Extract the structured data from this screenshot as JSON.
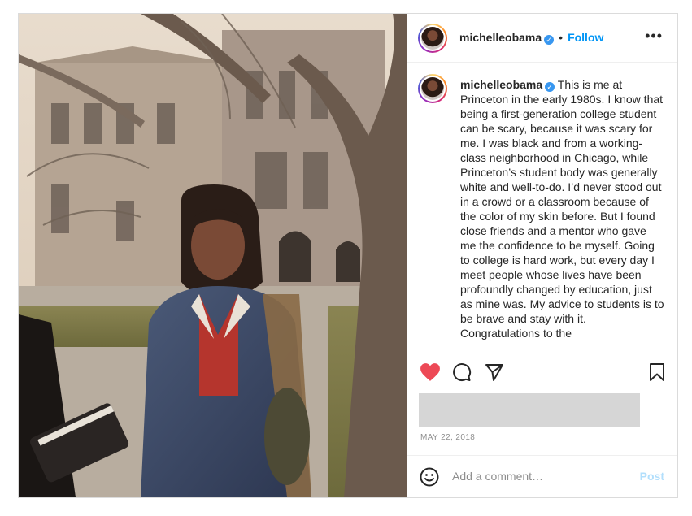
{
  "post": {
    "username": "michelleobama",
    "verified": true,
    "follow_label": "Follow",
    "header_separator": "•",
    "more_label": "•••",
    "caption": "This is me at Princeton in the early 1980s. I know that being a first-generation college student can be scary, because it was scary for me. I was black and from a working-class neighborhood in Chicago, while Princeton’s student body was generally white and well-to-do. I’d never stood out in a crowd or a classroom because of the color of my skin before. But I found close friends and a mentor who gave me the confidence to be myself. Going to college is hard work, but every day I meet people whose lives have been profoundly changed by education, just as mine was. My advice to students is to be brave and stay with it. Congratulations to the",
    "date": "MAY 22, 2018",
    "liked": true
  },
  "comment": {
    "placeholder": "Add a comment…",
    "post_label": "Post"
  },
  "icons": {
    "like": "heart-icon",
    "comment": "comment-icon",
    "share": "paper-plane-icon",
    "save": "bookmark-icon",
    "emoji": "smiley-icon",
    "verified": "verified-badge-icon"
  },
  "colors": {
    "heart": "#ed4956",
    "link": "#0095f6",
    "post_disabled": "#b2dffc",
    "muted": "#8e8e8e"
  }
}
